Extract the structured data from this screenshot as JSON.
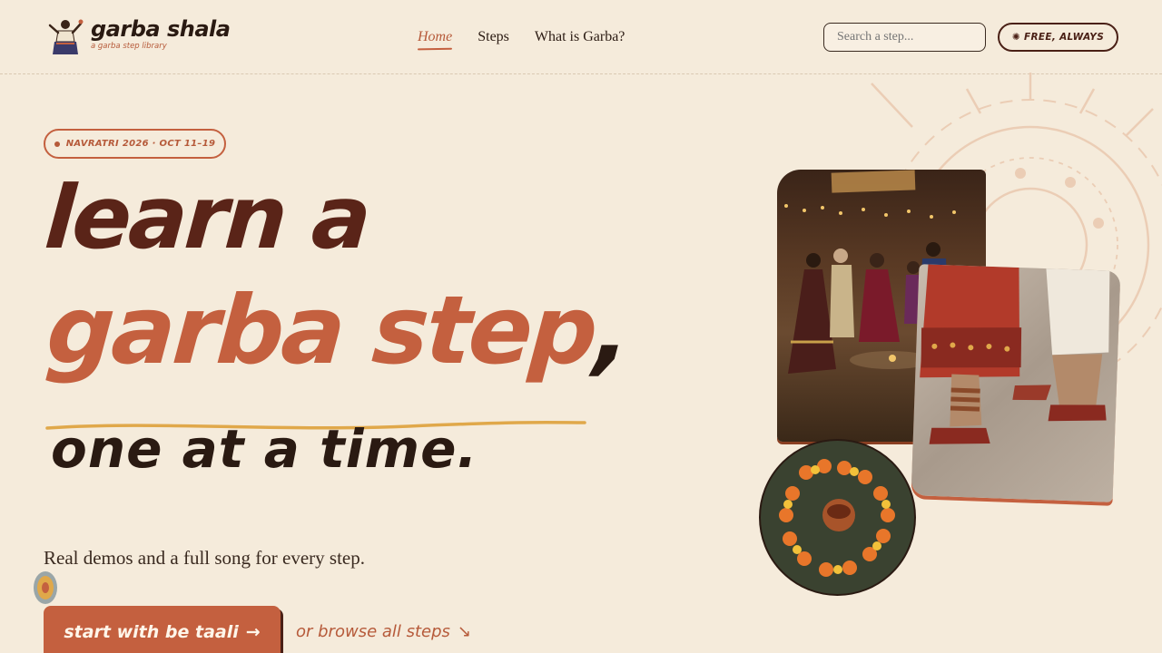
{
  "header": {
    "logo_title": "garba shala",
    "logo_subtitle": "a garba step library",
    "nav": [
      {
        "label": "Home",
        "active": true
      },
      {
        "label": "Steps",
        "active": false
      },
      {
        "label": "What is Garba?",
        "active": false
      }
    ],
    "search_placeholder": "Search a step...",
    "free_badge": "FREE, ALWAYS",
    "free_badge_icon": "✺"
  },
  "hero": {
    "badge": "NAVRATRI 2026 · OCT 11–19",
    "line1": "learn a",
    "line2": "garba step",
    "line2_comma": ",",
    "line3": "one at a time.",
    "lede": "Real demos and a full song for every step.",
    "cta_label": "start with be taali",
    "cta_arrow": "→",
    "browse_label": "or browse all steps",
    "browse_arrow": "↘"
  },
  "colors": {
    "background": "#f5ebdb",
    "accent": "#c4603f",
    "dark": "#5a2418",
    "gold": "#e0a84a"
  }
}
